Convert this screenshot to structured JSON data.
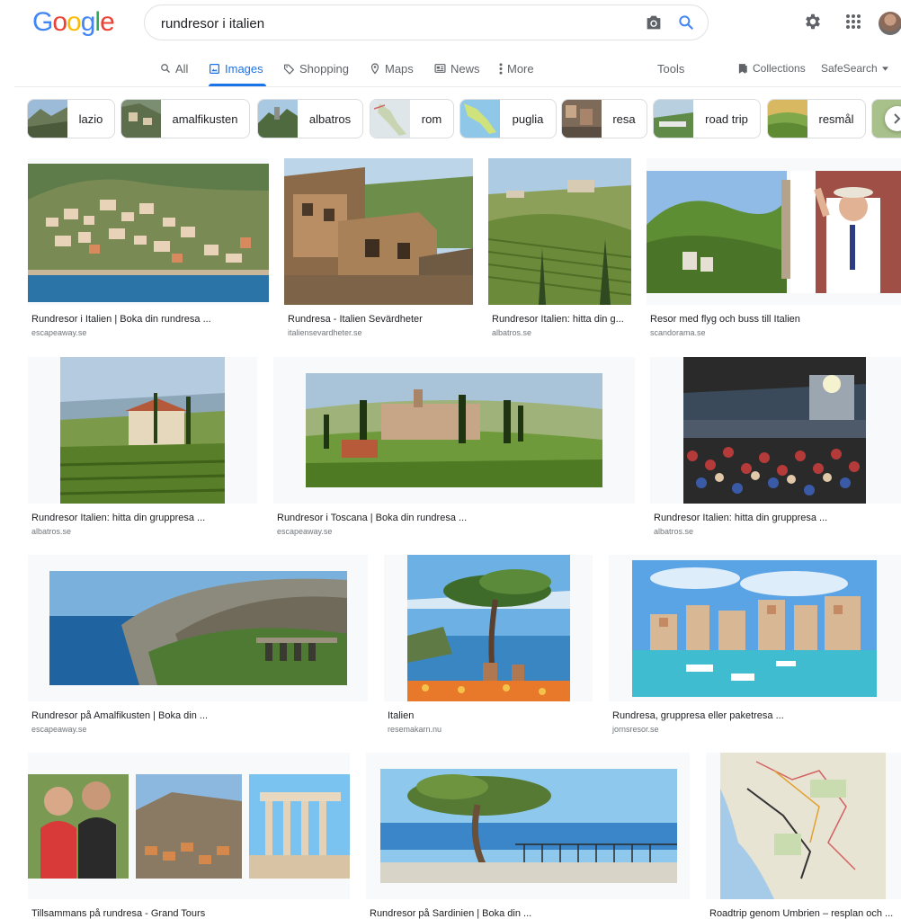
{
  "search": {
    "query": "rundresor i italien",
    "logo_letters": [
      {
        "ch": "G",
        "color": "#4285f4"
      },
      {
        "ch": "o",
        "color": "#ea4335"
      },
      {
        "ch": "o",
        "color": "#fbbc05"
      },
      {
        "ch": "g",
        "color": "#4285f4"
      },
      {
        "ch": "l",
        "color": "#34a853"
      },
      {
        "ch": "e",
        "color": "#ea4335"
      }
    ]
  },
  "tabs": {
    "all": "All",
    "images": "Images",
    "shopping": "Shopping",
    "maps": "Maps",
    "news": "News",
    "more": "More",
    "tools": "Tools",
    "collections": "Collections",
    "safesearch": "SafeSearch"
  },
  "chips": [
    "lazio",
    "amalfikusten",
    "albatros",
    "rom",
    "puglia",
    "resa",
    "road trip",
    "resmål"
  ],
  "results": [
    {
      "title": "Rundresor i Italien | Boka din rundresa ...",
      "source": "escapeaway.se"
    },
    {
      "title": "Rundresa - Italien Sevärdheter",
      "source": "italiensevardheter.se"
    },
    {
      "title": "Rundresor Italien: hitta din g...",
      "source": "albatros.se"
    },
    {
      "title": "Resor med flyg och buss till Italien",
      "source": "scandorama.se"
    },
    {
      "title": "Rundresor Italien: hitta din gruppresa ...",
      "source": "albatros.se"
    },
    {
      "title": "Rundresor i Toscana | Boka din rundresa ...",
      "source": "escapeaway.se"
    },
    {
      "title": "Rundresor Italien: hitta din gruppresa ...",
      "source": "albatros.se"
    },
    {
      "title": "Rundresor på Amalfikusten | Boka din ...",
      "source": "escapeaway.se"
    },
    {
      "title": "Italien",
      "source": "resemakarn.nu"
    },
    {
      "title": "Rundresa, gruppresa eller paketresa ...",
      "source": "jornsresor.se"
    },
    {
      "title": "Tillsammans på rundresa - Grand Tours",
      "source": ""
    },
    {
      "title": "Rundresor på Sardinien | Boka din ...",
      "source": ""
    },
    {
      "title": "Roadtrip genom Umbrien – resplan och ...",
      "source": ""
    }
  ],
  "colors": {
    "accent": "#1a73e8",
    "muted_text": "#5f6368",
    "source_text": "#70757a"
  }
}
